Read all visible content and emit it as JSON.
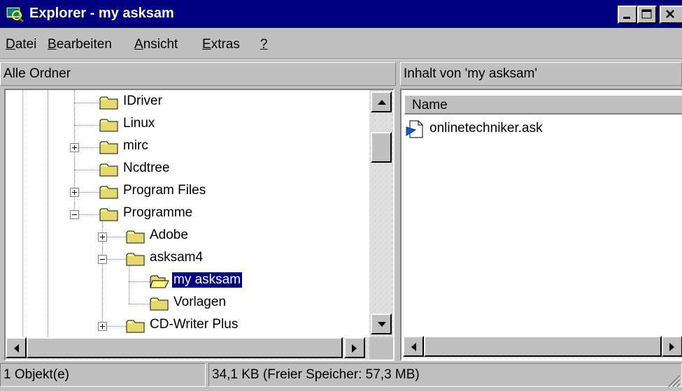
{
  "window": {
    "title": "Explorer - my asksam",
    "title_icon": "explorer-icon",
    "controls": [
      "minimize-icon",
      "maximize-icon",
      "close-icon"
    ]
  },
  "menu": {
    "items": [
      {
        "first": "D",
        "rest": "atei"
      },
      {
        "first": "B",
        "rest": "earbeiten"
      },
      {
        "first": "A",
        "rest": "nsicht"
      },
      {
        "first": "E",
        "rest": "xtras"
      },
      {
        "first": "?",
        "rest": ""
      }
    ]
  },
  "left_pane": {
    "header": "Alle Ordner",
    "tree": [
      {
        "label": "IDriver",
        "expander": "none",
        "selected": false
      },
      {
        "label": "Linux",
        "expander": "none",
        "selected": false
      },
      {
        "label": "mirc",
        "expander": "plus",
        "selected": false
      },
      {
        "label": "Ncdtree",
        "expander": "none",
        "selected": false
      },
      {
        "label": "Program Files",
        "expander": "plus",
        "selected": false
      },
      {
        "label": "Programme",
        "expander": "minus",
        "selected": false
      },
      {
        "label": "Adobe",
        "expander": "plus",
        "selected": false
      },
      {
        "label": "asksam4",
        "expander": "minus",
        "selected": false
      },
      {
        "label": "my asksam",
        "expander": "none",
        "selected": true
      },
      {
        "label": "Vorlagen",
        "expander": "none",
        "selected": false
      },
      {
        "label": "CD-Writer Plus",
        "expander": "plus",
        "selected": false
      }
    ]
  },
  "right_pane": {
    "header": "Inhalt von 'my asksam'",
    "column_name": "Name",
    "files": [
      {
        "name": "onlinetechniker.ask",
        "icon": "asksam-file-icon"
      }
    ]
  },
  "status": {
    "objects": "1 Objekt(e)",
    "size": "34,1 KB (Freier Speicher: 57,3 MB)"
  }
}
